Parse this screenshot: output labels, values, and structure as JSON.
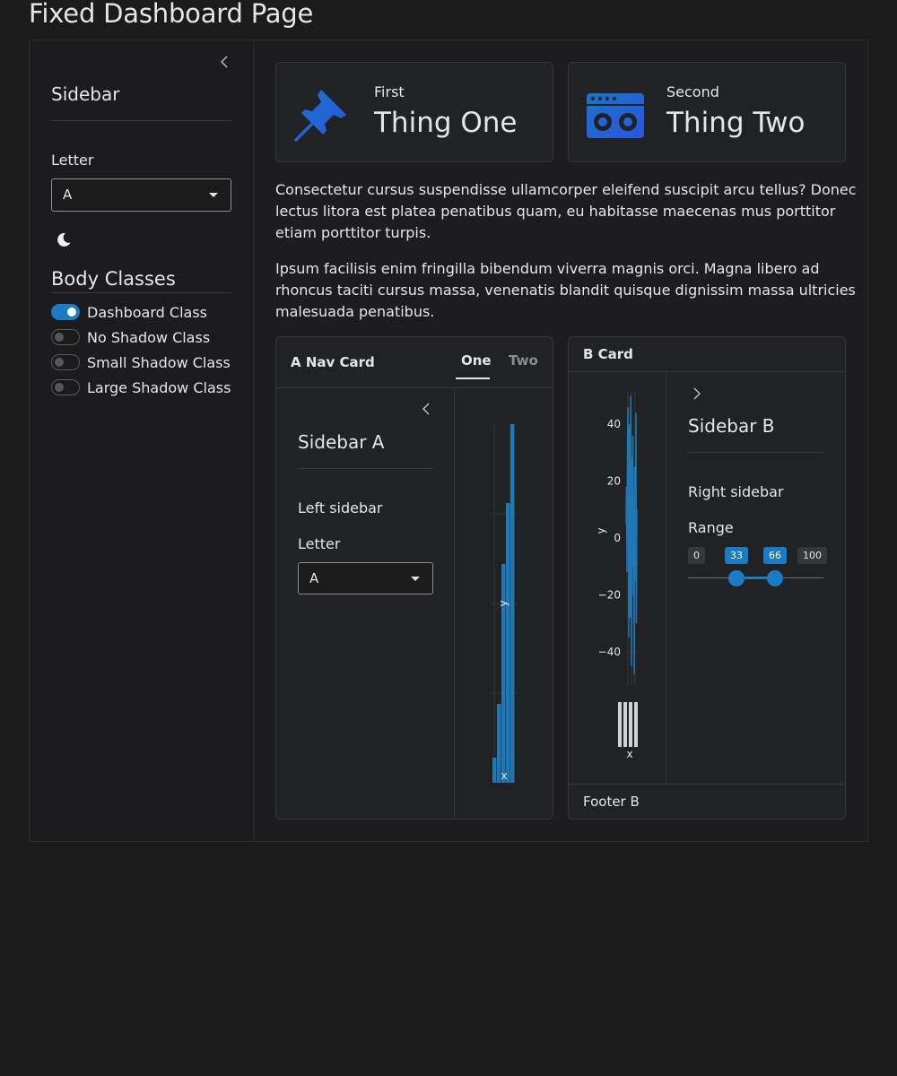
{
  "page": {
    "title": "Fixed Dashboard Page"
  },
  "sidebar": {
    "title": "Sidebar",
    "letter_label": "Letter",
    "letter_value": "A",
    "dark_mode_icon": "moon-icon",
    "body_classes_heading": "Body Classes",
    "switches": [
      {
        "label": "Dashboard Class",
        "on": true
      },
      {
        "label": "No Shadow Class",
        "on": false
      },
      {
        "label": "Small Shadow Class",
        "on": false
      },
      {
        "label": "Large Shadow Class",
        "on": false
      }
    ]
  },
  "value_boxes": [
    {
      "small": "First",
      "big": "Thing One",
      "icon": "pushpin-icon"
    },
    {
      "small": "Second",
      "big": "Thing Two",
      "icon": "boombox-icon"
    }
  ],
  "paragraphs": [
    "Consectetur cursus suspendisse ullamcorper eleifend suscipit arcu tellus? Donec lectus litora est platea penatibus quam, eu habitasse maecenas mus porttitor etiam porttitor turpis.",
    "Ipsum facilisis enim fringilla bibendum viverra magnis orci. Magna libero ad rhoncus taciti cursus massa, venenatis blandit quisque dignissim massa ultricies malesuada penatibus."
  ],
  "card_a": {
    "title": "A Nav Card",
    "tabs": [
      "One",
      "Two"
    ],
    "active_tab": "One",
    "sidebar_title": "Sidebar A",
    "sidebar_text": "Left sidebar",
    "letter_label": "Letter",
    "letter_value": "A"
  },
  "card_b": {
    "title": "B Card",
    "sidebar_title": "Sidebar B",
    "sidebar_text": "Right sidebar",
    "range_label": "Range",
    "range": {
      "min": 0,
      "max": 100,
      "low": 33,
      "high": 66
    },
    "range_labels": [
      "0",
      "33",
      "66",
      "100"
    ],
    "footer": "Footer B"
  },
  "colors": {
    "accent": "#1b7bc4",
    "background": "#1b1b1c",
    "card": "#212224"
  },
  "chart_data": [
    {
      "type": "bar",
      "xlabel": "x",
      "ylabel": "y",
      "values": [
        7,
        22,
        61,
        78,
        100
      ]
    },
    {
      "type": "line",
      "xlabel": "x",
      "ylabel": "y",
      "yticks": [
        -40,
        -20,
        0,
        20,
        40
      ],
      "ylim": [
        -52,
        52
      ],
      "values": [
        5,
        18,
        -12,
        30,
        46,
        22,
        -35,
        40,
        12,
        -28,
        50,
        8,
        -45,
        28,
        -10,
        36,
        -20,
        15,
        -48,
        25,
        2,
        -15,
        44,
        -30,
        10
      ]
    }
  ]
}
